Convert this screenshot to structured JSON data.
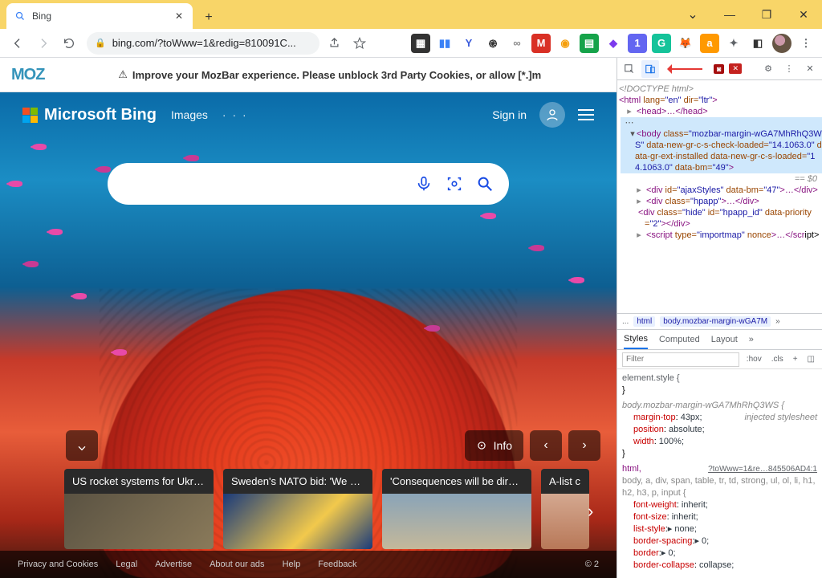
{
  "browser": {
    "tab": {
      "title": "Bing",
      "favicon": "search"
    },
    "url": "bing.com/?toWww=1&redig=810091C...",
    "nav": {
      "back": "←",
      "forward": "→",
      "reload": "⟳"
    },
    "window": {
      "min": "—",
      "max": "❐",
      "close": "✕",
      "chevron": "⌄"
    },
    "extensions": [
      {
        "name": "ext-dark",
        "bg": "#333",
        "fg": "#fff",
        "label": "▦"
      },
      {
        "name": "ext-blue",
        "bg": "#fff",
        "fg": "#3b82f6",
        "label": "▮▮"
      },
      {
        "name": "ext-vivaldi",
        "bg": "#fff",
        "fg": "#3b5bdb",
        "label": "Y"
      },
      {
        "name": "ext-spiral",
        "bg": "#fff",
        "fg": "#333",
        "label": "֎"
      },
      {
        "name": "ext-link",
        "bg": "#fff",
        "fg": "#888",
        "label": "∞"
      },
      {
        "name": "ext-gmail",
        "bg": "#d93025",
        "fg": "#fff",
        "label": "M"
      },
      {
        "name": "ext-rainbow",
        "bg": "#fff",
        "fg": "#f59e0b",
        "label": "◉"
      },
      {
        "name": "ext-green",
        "bg": "#16a34a",
        "fg": "#fff",
        "label": "▤"
      },
      {
        "name": "ext-purple",
        "bg": "#fff",
        "fg": "#7c3aed",
        "label": "◆"
      },
      {
        "name": "ext-one",
        "bg": "#6366f1",
        "fg": "#fff",
        "label": "1"
      },
      {
        "name": "ext-grammarly",
        "bg": "#15c39a",
        "fg": "#fff",
        "label": "G"
      },
      {
        "name": "ext-metamask",
        "bg": "#fff",
        "fg": "#f6851b",
        "label": "🦊"
      },
      {
        "name": "ext-amazon",
        "bg": "#ff9900",
        "fg": "#fff",
        "label": "a"
      },
      {
        "name": "ext-puzzle",
        "bg": "#fff",
        "fg": "#5f6368",
        "label": "✦"
      },
      {
        "name": "ext-panel",
        "bg": "#fff",
        "fg": "#333",
        "label": "◧"
      }
    ],
    "avatar": "●",
    "menu": "⋮"
  },
  "mozbar": {
    "logo": "MOZ",
    "warning_icon": "⚠",
    "message": "Improve your MozBar experience. Please unblock 3rd Party Cookies, or allow [*.]m"
  },
  "bing": {
    "logo": "Microsoft Bing",
    "nav": {
      "images": "Images",
      "more": "· · ·"
    },
    "signin": "Sign in",
    "search_placeholder": "",
    "icons": {
      "mic": "mic",
      "lens": "lens",
      "search": "search"
    },
    "info": "Info",
    "news": [
      {
        "title": "US rocket systems for Ukra..."
      },
      {
        "title": "Sweden's NATO bid: 'We ar..."
      },
      {
        "title": "'Consequences will be dire'..."
      },
      {
        "title": "A-list c"
      }
    ],
    "footer": {
      "links": [
        "Privacy and Cookies",
        "Legal",
        "Advertise",
        "About our ads",
        "Help",
        "Feedback"
      ],
      "copyright": "© 2"
    }
  },
  "devtools": {
    "badges": {
      "errors": "◙",
      "issues": "✕"
    },
    "dom": {
      "l1": "<!DOCTYPE html>",
      "l2_open": "<html",
      "l2_lang_k": "lang=",
      "l2_lang_v": "\"en\"",
      "l2_dir_k": "dir=",
      "l2_dir_v": "\"ltr\"",
      "l2_close": ">",
      "l3": "<head>…</head>",
      "l4_a": "<body ",
      "l4_b": "class=",
      "l4_c": "\"mozbar-margin-wGA7MhRhQ3WS\"",
      "l4_d": " data-new-gr-c-s-check-loaded=",
      "l4_e": "\"14.1063.0\"",
      "l4_f": " data-gr-ext-installed data-new-gr-c-s-loaded=",
      "l4_g": "\"14.1063.0\"",
      "l4_h": " data-bm=",
      "l4_i": "\"49\"",
      "l4_j": ">",
      "l5": "== $0",
      "l6_a": "<div ",
      "l6_b": "id=",
      "l6_c": "\"ajaxStyles\"",
      "l6_d": " data-bm=",
      "l6_e": "\"47\"",
      "l6_f": ">…</div>",
      "l7_a": "<div ",
      "l7_b": "class=",
      "l7_c": "\"hpapp\"",
      "l7_d": ">…</div>",
      "l8_a": "<div ",
      "l8_b": "class=",
      "l8_c": "\"hide\"",
      "l8_d": " id=",
      "l8_e": "\"hpapp_id\"",
      "l8_f": " data-priority=",
      "l8_g": "\"2\"",
      "l8_h": "></div>",
      "l9_a": "<script ",
      "l9_b": "type=",
      "l9_c": "\"importmap\"",
      "l9_d": " nonce",
      "l9_e": ">…</scr"
    },
    "breadcrumbs": {
      "ellipsis": "...",
      "html": "html",
      "body": "body.mozbar-margin-wGA7M",
      "more": "»"
    },
    "tabs": {
      "styles": "Styles",
      "computed": "Computed",
      "layout": "Layout",
      "more": "»"
    },
    "filter": {
      "placeholder": "Filter",
      "hov": ":hov",
      "cls": ".cls",
      "plus": "+",
      "panel": "◫"
    },
    "styles": {
      "inline": {
        "sel": "element.style {",
        "close": "}"
      },
      "moz": {
        "sel": "body.mozbar-margin-wGA7MhRhQ3WS {",
        "injected": "injected stylesheet",
        "p1_k": "margin-top",
        "p1_v": " 43px;",
        "p2_k": "position",
        "p2_v": " absolute;",
        "p3_k": "width",
        "p3_v": " 100%;",
        "close": "}"
      },
      "ua": {
        "link": "?toWww=1&re…845506AD4:1",
        "elements": "html,",
        "sel": "body, a, div, span, table, tr, td, strong, ul, ol, li, h1, h2, h3, p, input {",
        "p1_k": "font-weight",
        "p1_v": " inherit;",
        "p2_k": "font-size",
        "p2_v": " inherit;",
        "p3_k": "list-style",
        "p3_v": "▸ none;",
        "p4_k": "border-spacing",
        "p4_v": "▸ 0;",
        "p5_k": "border",
        "p5_v": "▸ 0;",
        "p6_k": "border-collapse",
        "p6_v": " collapse;"
      }
    }
  }
}
